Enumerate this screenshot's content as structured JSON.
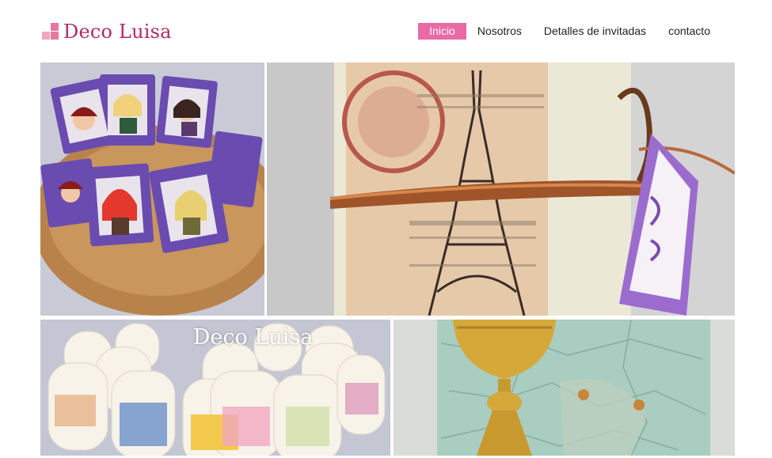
{
  "header": {
    "logo_text": "Deco Luisa",
    "brand_color": "#b02a67",
    "accent_color": "#e96aa7"
  },
  "nav": {
    "items": [
      {
        "label": "Inicio",
        "active": true
      },
      {
        "label": "Nosotros",
        "active": false
      },
      {
        "label": "Detalles de invitadas",
        "active": false
      },
      {
        "label": "contacto",
        "active": false
      }
    ]
  },
  "gallery": {
    "tiles": [
      {
        "subject": "basket of doll souvenir cards"
      },
      {
        "subject": "candle with eiffel tower and label tag"
      },
      {
        "subject": "decorated candles",
        "caption": "Deco Luisa"
      },
      {
        "subject": "chalice decoupage candle"
      }
    ]
  }
}
